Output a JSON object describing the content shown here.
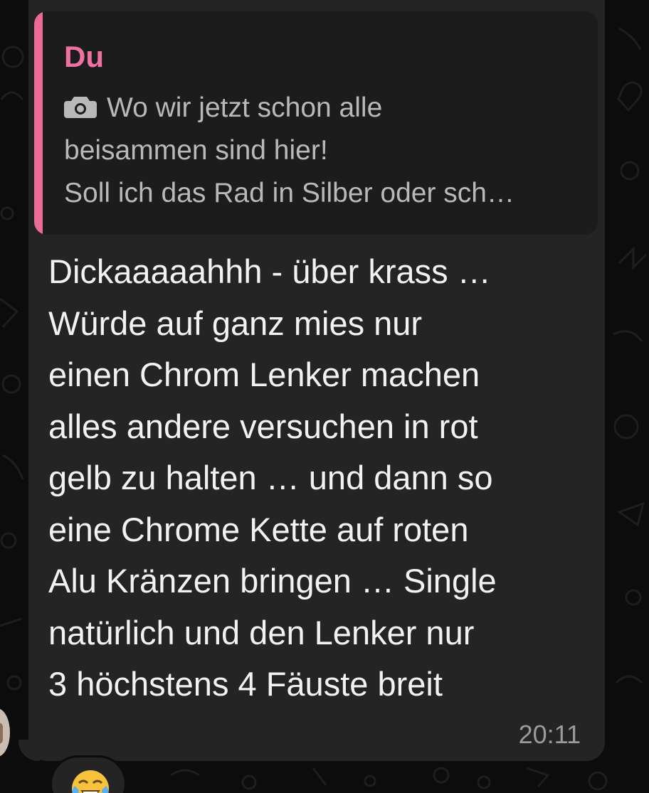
{
  "quoted_message": {
    "author": "Du",
    "icon": "camera-icon",
    "line1": "Wo wir jetzt schon alle",
    "line2": "beisammen sind hier!",
    "line3": "Soll ich das Rad in Silber oder sch…"
  },
  "message": {
    "text": "Dickaaaaahhh - über krass …\nWürde auf ganz mies nur\neinen Chrom Lenker machen\nalles andere versuchen in rot\ngelb zu halten … und dann so\neine Chrome Kette auf roten\nAlu Kränzen bringen … Single\nnatürlich und den Lenker nur\n3 höchstens 4 Fäuste breit",
    "time": "20:11"
  },
  "reaction": {
    "icon": "tears-of-joy-emoji"
  },
  "colors": {
    "bubble": "#242424",
    "quote_background": "#1c1c1c",
    "quote_accent": "#ec6a96",
    "author": "#ef71a0",
    "message_text": "#f2f2f2",
    "quoted_text": "#b9b9b9",
    "timestamp": "#9a9a9a"
  }
}
